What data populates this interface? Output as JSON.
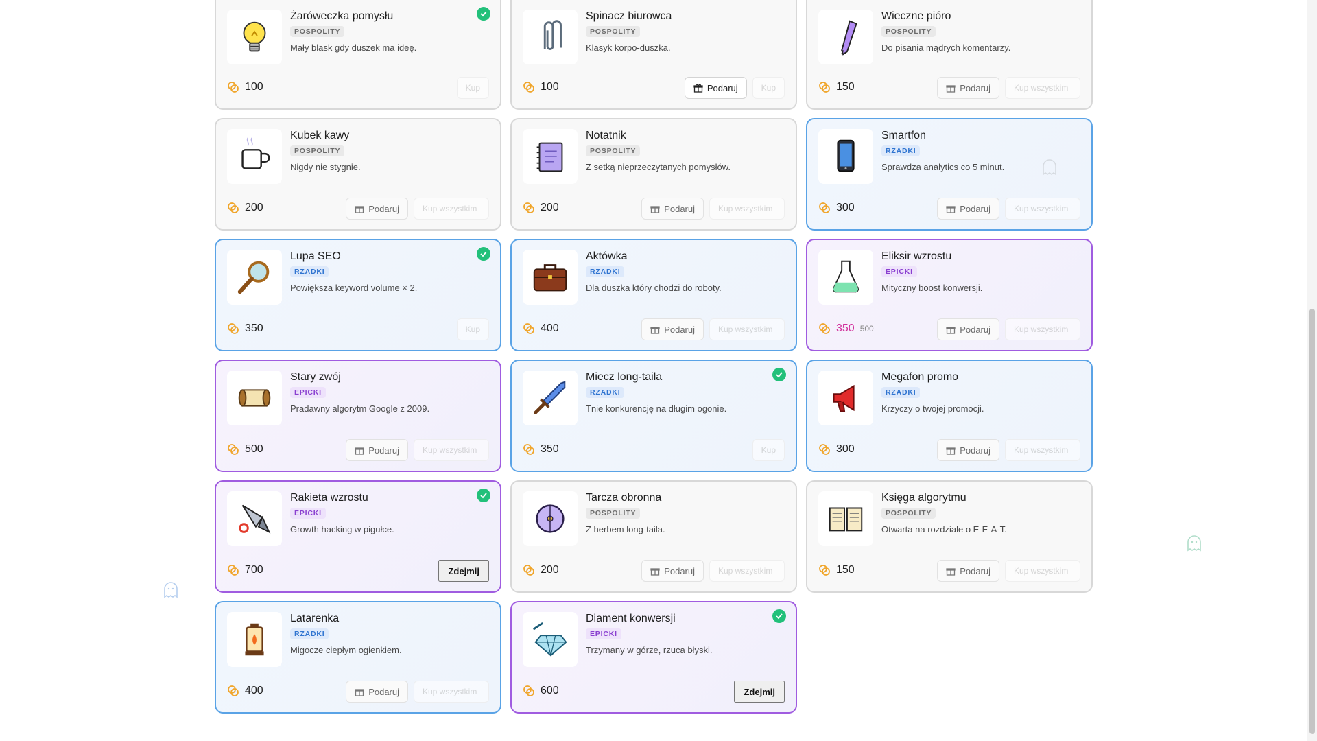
{
  "labels": {
    "gift": "Podaruj",
    "take_off": "Zdejmij",
    "buy": "Kup",
    "buy_for_all": "Kup wszystkim"
  },
  "colors": {
    "rzadki_border": "#5aa3e6",
    "epicki_border": "#a05ce0",
    "owned_check": "#22c07a",
    "sale_price": "#d1309b"
  },
  "items": [
    {
      "name": "Żaróweczka pomysłu",
      "rarity": "POSPOLITY",
      "desc": "Mały blask gdy duszek ma ideę.",
      "price": "100",
      "owned": true,
      "icon": "lightbulb-icon"
    },
    {
      "name": "Spinacz biurowca",
      "rarity": "POSPOLITY",
      "desc": "Klasyk korpo-duszka.",
      "price": "100",
      "owned": false,
      "icon": "paperclip-icon"
    },
    {
      "name": "Wieczne pióro",
      "rarity": "POSPOLITY",
      "desc": "Do pisania mądrych komentarzy.",
      "price": "150",
      "owned": false,
      "icon": "pen-icon"
    },
    {
      "name": "Kubek kawy",
      "rarity": "POSPOLITY",
      "desc": "Nigdy nie stygnie.",
      "price": "200",
      "owned": false,
      "icon": "coffee-mug-icon"
    },
    {
      "name": "Notatnik",
      "rarity": "POSPOLITY",
      "desc": "Z setką nieprzeczytanych pomysłów.",
      "price": "200",
      "owned": false,
      "icon": "notebook-icon"
    },
    {
      "name": "Smartfon",
      "rarity": "RZADKI",
      "desc": "Sprawdza analytics co 5 minut.",
      "price": "300",
      "owned": false,
      "icon": "smartphone-icon"
    },
    {
      "name": "Lupa SEO",
      "rarity": "RZADKI",
      "desc": "Powiększa keyword volume × 2.",
      "price": "350",
      "owned": true,
      "icon": "magnifier-icon"
    },
    {
      "name": "Aktówka",
      "rarity": "RZADKI",
      "desc": "Dla duszka który chodzi do roboty.",
      "price": "400",
      "owned": false,
      "icon": "briefcase-icon"
    },
    {
      "name": "Eliksir wzrostu",
      "rarity": "EPICKI",
      "desc": "Mityczny boost konwersji.",
      "price": "350",
      "old_price": "500",
      "owned": false,
      "icon": "potion-icon"
    },
    {
      "name": "Stary zwój",
      "rarity": "EPICKI",
      "desc": "Pradawny algorytm Google z 2009.",
      "price": "500",
      "owned": false,
      "icon": "scroll-icon"
    },
    {
      "name": "Miecz long-taila",
      "rarity": "RZADKI",
      "desc": "Tnie konkurencję na długim ogonie.",
      "price": "350",
      "owned": true,
      "icon": "sword-icon"
    },
    {
      "name": "Megafon promo",
      "rarity": "RZADKI",
      "desc": "Krzyczy o twojej promocji.",
      "price": "300",
      "owned": false,
      "icon": "megaphone-icon"
    },
    {
      "name": "Rakieta wzrostu",
      "rarity": "EPICKI",
      "desc": "Growth hacking w pigułce.",
      "price": "700",
      "owned": true,
      "equipped": true,
      "icon": "rocket-icon"
    },
    {
      "name": "Tarcza obronna",
      "rarity": "POSPOLITY",
      "desc": "Z herbem long-taila.",
      "price": "200",
      "owned": false,
      "icon": "shield-icon"
    },
    {
      "name": "Księga algorytmu",
      "rarity": "POSPOLITY",
      "desc": "Otwarta na rozdziale o E-E-A-T.",
      "price": "150",
      "owned": false,
      "icon": "book-icon"
    },
    {
      "name": "Latarenka",
      "rarity": "RZADKI",
      "desc": "Migocze ciepłym ogienkiem.",
      "price": "400",
      "owned": false,
      "icon": "lantern-icon"
    },
    {
      "name": "Diament konwersji",
      "rarity": "EPICKI",
      "desc": "Trzymany w górze, rzuca błyski.",
      "price": "600",
      "owned": true,
      "equipped": true,
      "icon": "diamond-icon"
    }
  ]
}
